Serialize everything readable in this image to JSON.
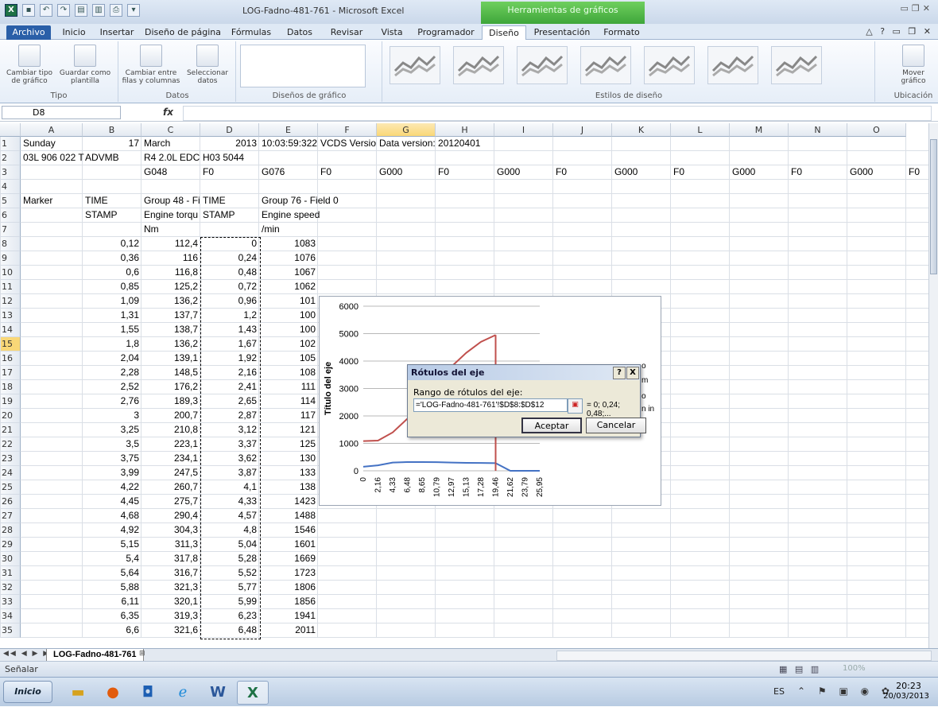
{
  "window": {
    "title": "LOG-Fadno-481-761 - Microsoft Excel",
    "context_tab_title": "Herramientas de gráficos"
  },
  "ribbon_tabs": [
    "Archivo",
    "Inicio",
    "Insertar",
    "Diseño de página",
    "Fórmulas",
    "Datos",
    "Revisar",
    "Vista",
    "Programador",
    "Diseño",
    "Presentación",
    "Formato"
  ],
  "ribbon": {
    "tipo": {
      "btn1_line1": "Cambiar tipo",
      "btn1_line2": "de gráfico",
      "btn2_line1": "Guardar como",
      "btn2_line2": "plantilla",
      "label": "Tipo"
    },
    "datos": {
      "btn1_line1": "Cambiar entre",
      "btn1_line2": "filas y columnas",
      "btn2_line1": "Seleccionar",
      "btn2_line2": "datos",
      "label": "Datos"
    },
    "disenos": {
      "label": "Diseños de gráfico"
    },
    "estilos": {
      "label": "Estilos de diseño"
    },
    "ubicacion": {
      "btn_line1": "Mover",
      "btn_line2": "gráfico",
      "label": "Ubicación"
    }
  },
  "formula_bar": {
    "name_box": "D8",
    "fx": "fx",
    "value": ""
  },
  "columns": [
    "A",
    "B",
    "C",
    "D",
    "E",
    "F",
    "G",
    "H",
    "I",
    "J",
    "K",
    "L",
    "M",
    "N",
    "O"
  ],
  "rows": [
    "1",
    "2",
    "3",
    "4",
    "5",
    "6",
    "7",
    "8",
    "9",
    "10",
    "11",
    "12",
    "13",
    "14",
    "15",
    "16",
    "17",
    "18",
    "19",
    "20",
    "21",
    "22",
    "23",
    "24",
    "25",
    "26",
    "27",
    "28",
    "29",
    "30",
    "31",
    "32",
    "33",
    "34",
    "35"
  ],
  "header_cells": {
    "A1": "Sunday",
    "B1": "17",
    "C1": "March",
    "D1": "2013",
    "E1": "10:03:59:322",
    "F1": "VCDS Versio",
    "G1": "Data version: 20120401",
    "A2": "03L 906 022 T",
    "B2": "ADVMB",
    "C2": "R4 2.0L EDC",
    "D2": "H03 5044",
    "C3": "G048",
    "D3": "F0",
    "E3": "G076",
    "F3": "F0",
    "G3": "G000",
    "H3": "F0",
    "I3": "G000",
    "J3": "F0",
    "K3": "G000",
    "L3": "F0",
    "M3": "G000",
    "N3": "F0",
    "O3": "G000",
    "P3": "F0",
    "A5": "Marker",
    "B5": "TIME",
    "C5": "Group 48 - Fi",
    "D5": "TIME",
    "E5": "Group 76 - Field 0",
    "B6": "STAMP",
    "C6": "Engine torqu",
    "D6": "STAMP",
    "E6": "Engine speed",
    "C7": "Nm",
    "E7": "/min"
  },
  "data_rows": [
    [
      "0,12",
      "112,4",
      "0",
      "1083"
    ],
    [
      "0,36",
      "116",
      "0,24",
      "1076"
    ],
    [
      "0,6",
      "116,8",
      "0,48",
      "1067"
    ],
    [
      "0,85",
      "125,2",
      "0,72",
      "1062"
    ],
    [
      "1,09",
      "136,2",
      "0,96",
      "101"
    ],
    [
      "1,31",
      "137,7",
      "1,2",
      "100"
    ],
    [
      "1,55",
      "138,7",
      "1,43",
      "100"
    ],
    [
      "1,8",
      "136,2",
      "1,67",
      "102"
    ],
    [
      "2,04",
      "139,1",
      "1,92",
      "105"
    ],
    [
      "2,28",
      "148,5",
      "2,16",
      "108"
    ],
    [
      "2,52",
      "176,2",
      "2,41",
      "111"
    ],
    [
      "2,76",
      "189,3",
      "2,65",
      "114"
    ],
    [
      "3",
      "200,7",
      "2,87",
      "117"
    ],
    [
      "3,25",
      "210,8",
      "3,12",
      "121"
    ],
    [
      "3,5",
      "223,1",
      "3,37",
      "125"
    ],
    [
      "3,75",
      "234,1",
      "3,62",
      "130"
    ],
    [
      "3,99",
      "247,5",
      "3,87",
      "133"
    ],
    [
      "4,22",
      "260,7",
      "4,1",
      "138"
    ],
    [
      "4,45",
      "275,7",
      "4,33",
      "1423"
    ],
    [
      "4,68",
      "290,4",
      "4,57",
      "1488"
    ],
    [
      "4,92",
      "304,3",
      "4,8",
      "1546"
    ],
    [
      "5,15",
      "311,3",
      "5,04",
      "1601"
    ],
    [
      "5,4",
      "317,8",
      "5,28",
      "1669"
    ],
    [
      "5,64",
      "316,7",
      "5,52",
      "1723"
    ],
    [
      "5,88",
      "321,3",
      "5,77",
      "1806"
    ],
    [
      "6,11",
      "320,1",
      "5,99",
      "1856"
    ],
    [
      "6,35",
      "319,3",
      "6,23",
      "1941"
    ],
    [
      "6,6",
      "321,6",
      "6,48",
      "2011"
    ]
  ],
  "chart": {
    "y_title": "Título del eje",
    "y_ticks": [
      "0",
      "1000",
      "2000",
      "3000",
      "4000",
      "5000",
      "6000"
    ],
    "x_ticks": [
      "0",
      "2,16",
      "4,33",
      "6,48",
      "8,65",
      "10,79",
      "12,97",
      "15,13",
      "17,28",
      "19,46",
      "21,62",
      "23,79",
      "25,95"
    ],
    "partial_labels": [
      "o",
      "m",
      "o",
      "n in"
    ],
    "series_colors": [
      "#4472c4",
      "#c0504d"
    ]
  },
  "chart_data": {
    "type": "line",
    "y_title": "Título del eje",
    "ylim": [
      0,
      6000
    ],
    "x": [
      "0",
      "2,16",
      "4,33",
      "6,48",
      "8,65",
      "10,79",
      "12,97",
      "15,13",
      "17,28",
      "19,46",
      "21,62",
      "23,79",
      "25,95"
    ],
    "series": [
      {
        "values": [
          150,
          200,
          300,
          320,
          320,
          315,
          300,
          290,
          285,
          280,
          0,
          0,
          0
        ]
      },
      {
        "values": [
          1083,
          1100,
          1400,
          1900,
          2500,
          3200,
          3800,
          4300,
          4700,
          4950,
          null,
          null,
          null
        ]
      }
    ]
  },
  "dialog": {
    "title": "Rótulos del eje",
    "help_btn": "?",
    "close_btn": "X",
    "label": "Rango de rótulos del eje:",
    "input_value": "='LOG-Fadno-481-761'!$D$8:$D$12",
    "preview": "= 0; 0,24; 0,48;...",
    "ok": "Aceptar",
    "cancel": "Cancelar"
  },
  "sheet_tab": "LOG-Fadno-481-761",
  "status": {
    "mode": "Señalar",
    "zoom": "100%"
  },
  "taskbar": {
    "start": "Inicio",
    "lang": "ES",
    "time": "20:23",
    "date": "20/03/2013"
  }
}
